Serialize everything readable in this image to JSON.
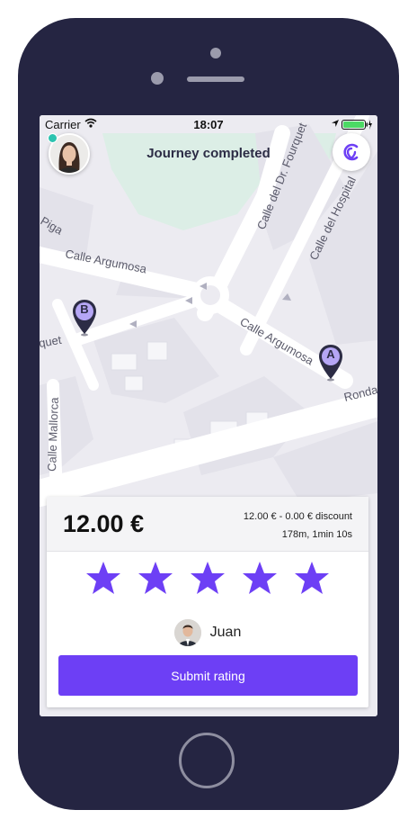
{
  "status_bar": {
    "carrier": "Carrier",
    "time": "18:07"
  },
  "header": {
    "title": "Journey completed"
  },
  "map": {
    "streets": [
      "Calle Argumosa",
      "Calle Argumosa",
      "Calle del Dr. Fourquet",
      "Calle del Hospital",
      "Calle Mallorca",
      "Ronda",
      "Piga",
      "quet"
    ],
    "pins": {
      "origin": "A",
      "destination": "B"
    }
  },
  "fare": {
    "total": "12.00 €",
    "breakdown": "12.00 € - 0.00 € discount",
    "detail": "178m, 1min 10s"
  },
  "rating": {
    "max_stars": 5,
    "selected": 5
  },
  "driver": {
    "name": "Juan"
  },
  "actions": {
    "submit_label": "Submit rating"
  },
  "colors": {
    "accent": "#6d3ff5",
    "frame": "#252542",
    "pin_fill": "#b5a6f5",
    "pin_body": "#2c2c45",
    "online": "#2cc3b0"
  }
}
